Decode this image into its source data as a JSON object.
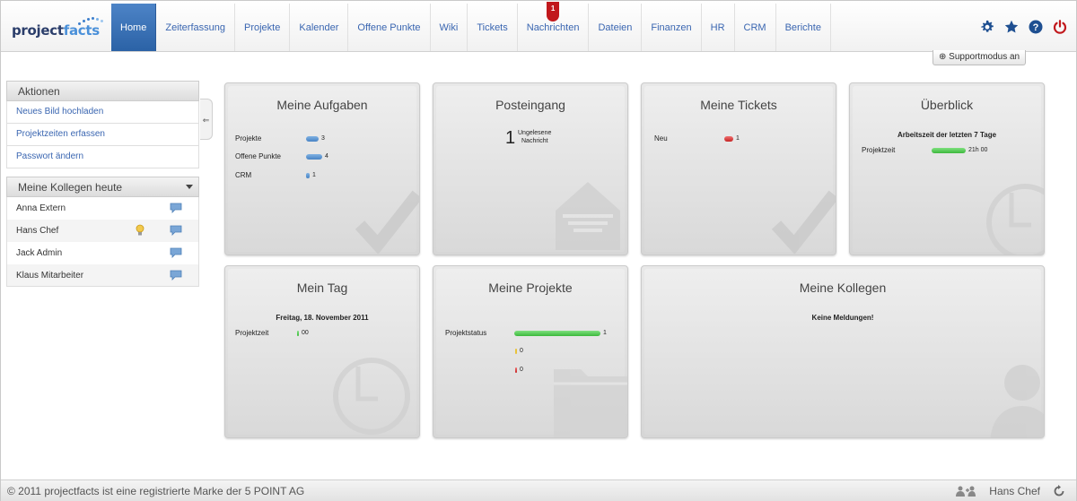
{
  "app": {
    "logo_part1": "project",
    "logo_part2": "facts"
  },
  "nav": {
    "items": [
      "Home",
      "Zeiterfassung",
      "Projekte",
      "Kalender",
      "Offene Punkte",
      "Wiki",
      "Tickets",
      "Nachrichten",
      "Dateien",
      "Finanzen",
      "HR",
      "CRM",
      "Berichte"
    ],
    "active": "Home",
    "nachrichten_badge": "1"
  },
  "top_icons": [
    "gear-icon",
    "star-icon",
    "help-icon",
    "power-icon"
  ],
  "support_button": "Supportmodus an",
  "sidebar": {
    "actions_title": "Aktionen",
    "actions": [
      "Neues Bild hochladen",
      "Projektzeiten erfassen",
      "Passwort ändern"
    ],
    "colleagues_title": "Meine Kollegen heute",
    "colleagues": [
      "Anna Extern",
      "Hans Chef",
      "Jack Admin",
      "Klaus Mitarbeiter"
    ]
  },
  "widgets": {
    "aufgaben": {
      "title": "Meine Aufgaben",
      "rows": [
        {
          "label": "Projekte",
          "count": "3"
        },
        {
          "label": "Offene Punkte",
          "count": "4"
        },
        {
          "label": "CRM",
          "count": "1"
        }
      ]
    },
    "posteingang": {
      "title": "Posteingang",
      "count": "1",
      "text_line1": "Ungelesene",
      "text_line2": "Nachricht"
    },
    "tickets": {
      "title": "Meine Tickets",
      "label": "Neu",
      "count": "1"
    },
    "ueberblick": {
      "title": "Überblick",
      "subtitle": "Arbeitszeit der letzten 7 Tage",
      "label": "Projektzeit",
      "value": "21h 00"
    },
    "tag": {
      "title": "Mein Tag",
      "date": "Freitag, 18. November 2011",
      "label": "Projektzeit",
      "value": "00"
    },
    "projekte": {
      "title": "Meine Projekte",
      "label": "Projektstatus",
      "count_green": "1",
      "count_yellow": "0",
      "count_red": "0"
    },
    "kollegen": {
      "title": "Meine Kollegen",
      "message": "Keine Meldungen!"
    }
  },
  "footer": {
    "copyright": "© 2011 projectfacts ist eine registrierte Marke der 5 POINT AG",
    "user": "Hans Chef"
  },
  "colors": {
    "nav_active": "#2b62a6",
    "link": "#3a66b1",
    "badge": "#c1181c",
    "bar_green": "#3cb83c",
    "bar_blue": "#4783c4",
    "bar_red": "#c52424"
  }
}
